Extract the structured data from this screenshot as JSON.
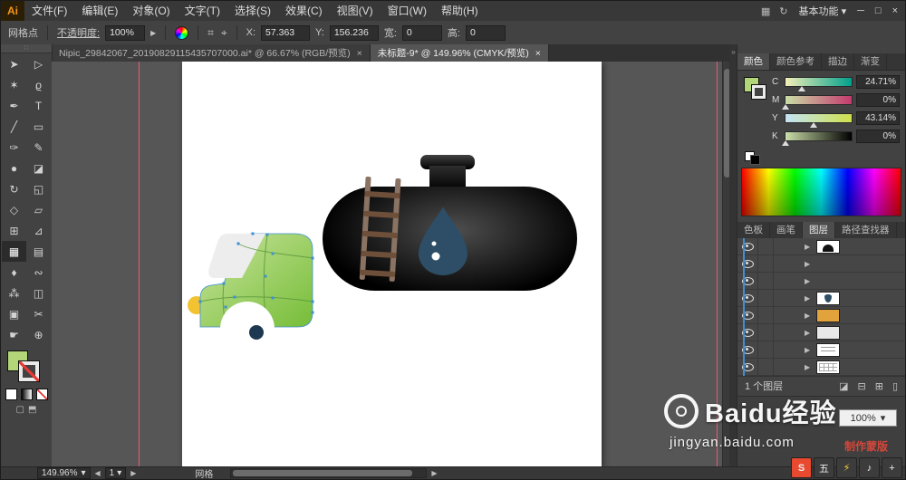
{
  "window": {
    "minimize": "─",
    "restore": "□",
    "close": "×"
  },
  "app": {
    "badge": "Ai"
  },
  "menubar": {
    "items": [
      "文件(F)",
      "编辑(E)",
      "对象(O)",
      "文字(T)",
      "选择(S)",
      "效果(C)",
      "视图(V)",
      "窗口(W)",
      "帮助(H)"
    ],
    "right_icons": [
      {
        "name": "arrange-documents-icon",
        "glyph": "▦"
      },
      {
        "name": "workspace-cycle-icon",
        "glyph": "↻"
      }
    ],
    "workspace": "基本功能",
    "workspace_arrow": "▾"
  },
  "controlbar": {
    "context": "网格点",
    "opacity_label": "不透明度:",
    "opacity_value": "100%",
    "opacity_arrow": "▸",
    "icons": [
      {
        "name": "align-icon",
        "glyph": "⌗"
      },
      {
        "name": "transform-icon",
        "glyph": "⌖"
      }
    ],
    "x_label": "X:",
    "x_value": "57.363",
    "y_label": "Y:",
    "y_value": "156.236",
    "w_label": "宽:",
    "w_value": "0",
    "h_label": "高:",
    "h_value": "0"
  },
  "doc_tabs": [
    {
      "title": "Nipic_29842067_20190829115435707000.ai* @ 66.67% (RGB/预览)",
      "close": "×",
      "active": false
    },
    {
      "title": "未标题-9* @ 149.96% (CMYK/预览)",
      "close": "×",
      "active": true
    }
  ],
  "toolbar": {
    "grip": "∷",
    "tools": [
      {
        "name": "selection-tool",
        "glyph": "➤"
      },
      {
        "name": "direct-selection-tool",
        "glyph": "▷"
      },
      {
        "name": "magic-wand-tool",
        "glyph": "✶"
      },
      {
        "name": "lasso-tool",
        "glyph": "ϱ"
      },
      {
        "name": "pen-tool",
        "glyph": "✒"
      },
      {
        "name": "type-tool",
        "glyph": "T"
      },
      {
        "name": "line-segment-tool",
        "glyph": "╱"
      },
      {
        "name": "rectangle-tool",
        "glyph": "▭"
      },
      {
        "name": "paintbrush-tool",
        "glyph": "✑"
      },
      {
        "name": "pencil-tool",
        "glyph": "✎"
      },
      {
        "name": "blob-brush-tool",
        "glyph": "●"
      },
      {
        "name": "eraser-tool",
        "glyph": "◪"
      },
      {
        "name": "rotate-tool",
        "glyph": "↻"
      },
      {
        "name": "scale-tool",
        "glyph": "◱"
      },
      {
        "name": "width-tool",
        "glyph": "◇"
      },
      {
        "name": "free-transform-tool",
        "glyph": "▱"
      },
      {
        "name": "shape-builder-tool",
        "glyph": "⊞"
      },
      {
        "name": "perspective-grid-tool",
        "glyph": "⊿"
      },
      {
        "name": "mesh-tool",
        "glyph": "▦",
        "active": true
      },
      {
        "name": "gradient-tool",
        "glyph": "▤"
      },
      {
        "name": "eyedropper-tool",
        "glyph": "♦"
      },
      {
        "name": "blend-tool",
        "glyph": "∾"
      },
      {
        "name": "symbol-sprayer-tool",
        "glyph": "⁂"
      },
      {
        "name": "column-graph-tool",
        "glyph": "◫"
      },
      {
        "name": "artboard-tool",
        "glyph": "▣"
      },
      {
        "name": "slice-tool",
        "glyph": "✂"
      },
      {
        "name": "hand-tool",
        "glyph": "☛"
      },
      {
        "name": "zoom-tool",
        "glyph": "⊕"
      }
    ]
  },
  "color_panel": {
    "tabs": [
      {
        "label": "颜色",
        "active": true
      },
      {
        "label": "颜色参考",
        "active": false
      },
      {
        "label": "描边",
        "active": false
      },
      {
        "label": "渐变",
        "active": false
      }
    ],
    "sliders": [
      {
        "channel": "C",
        "display": "24.71%",
        "pct": 24.71
      },
      {
        "channel": "M",
        "display": "0%",
        "pct": 0
      },
      {
        "channel": "Y",
        "display": "43.14%",
        "pct": 43.14
      },
      {
        "channel": "K",
        "display": "0%",
        "pct": 0
      }
    ]
  },
  "panel_tabs": [
    {
      "label": "色板",
      "active": false
    },
    {
      "label": "画笔",
      "active": false
    },
    {
      "label": "图层",
      "active": true
    },
    {
      "label": "路径查找器",
      "active": false
    }
  ],
  "layers": {
    "chevron": "▶",
    "rows": [
      {
        "thumb": "cap"
      },
      {
        "thumb": "tank"
      },
      {
        "thumb": "ladder"
      },
      {
        "thumb": "drop"
      },
      {
        "thumb": "amber"
      },
      {
        "thumb": "light"
      },
      {
        "thumb": "lines"
      },
      {
        "thumb": "grid"
      }
    ],
    "footer": "1 个图层",
    "footer_icons": [
      {
        "name": "make-clip-mask-icon",
        "glyph": "◪"
      },
      {
        "name": "new-sublayer-icon",
        "glyph": "⊟"
      },
      {
        "name": "new-layer-icon",
        "glyph": "⊞"
      },
      {
        "name": "delete-layer-icon",
        "glyph": "▯"
      }
    ]
  },
  "transparency": {
    "opacity_value": "100%",
    "opacity_arrow": "▾",
    "make_mask_label": "制作蒙版"
  },
  "watermark": {
    "brand": "Baidu经验",
    "url": "jingyan.baidu.com"
  },
  "statusbar": {
    "zoom": "149.96%",
    "dropdown": "▾",
    "nav_prev": "◀",
    "nav_next": "▶",
    "artboard_num": "1",
    "status": "网格",
    "scroll_arrow": "▶"
  },
  "dock": {
    "collapse": "»"
  },
  "tray": {
    "icons": [
      {
        "name": "ime-sogou-icon",
        "glyph": "S"
      },
      {
        "name": "ime-wubi-icon",
        "glyph": "五"
      },
      {
        "name": "ime-lightning-icon",
        "glyph": "⚡"
      },
      {
        "name": "ime-sound-icon",
        "glyph": "♪"
      },
      {
        "name": "ime-settings-icon",
        "glyph": "+"
      }
    ]
  },
  "colors": {
    "fill_green": "#b2d678",
    "accent_blue": "#3f8fd5",
    "guide_pink": "#f2566e",
    "cab_green_light": "#c9e49c",
    "cab_green": "#76bd38",
    "mesh_line_green": "#57943a",
    "windshield_gray": "#ededed",
    "tank_black": "#0a0a0a",
    "drop_blue": "#2d4e66",
    "ladder_brown": "#8a7362",
    "rung_brown": "#6e4f3a",
    "hub_navy": "#1d3850",
    "headlight_yellow": "#f2c230"
  }
}
